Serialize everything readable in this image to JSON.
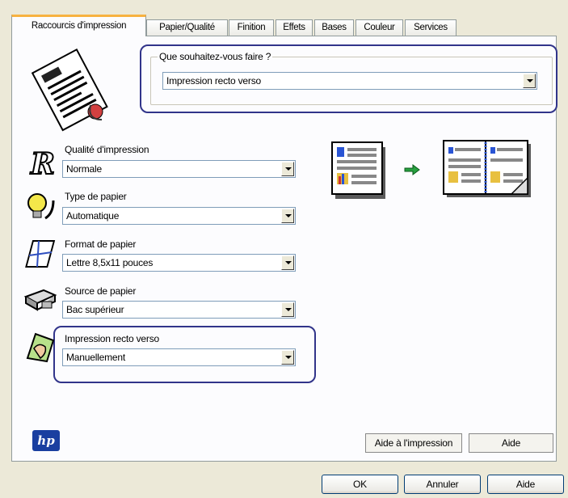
{
  "tabs": [
    "Raccourcis d'impression",
    "Papier/Qualité",
    "Finition",
    "Effets",
    "Bases",
    "Couleur",
    "Services"
  ],
  "task": {
    "label": "Que souhaitez-vous faire ?",
    "value": "Impression recto verso"
  },
  "quality": {
    "label": "Qualité d'impression",
    "value": "Normale"
  },
  "paper_type": {
    "label": "Type de papier",
    "value": "Automatique"
  },
  "paper_size": {
    "label": "Format de papier",
    "value": "Lettre 8,5x11 pouces"
  },
  "paper_source": {
    "label": "Source de papier",
    "value": "Bac supérieur"
  },
  "duplex": {
    "label": "Impression recto verso",
    "value": "Manuellement"
  },
  "buttons": {
    "print_help": "Aide à l'impression",
    "help": "Aide",
    "ok": "OK",
    "cancel": "Annuler",
    "help2": "Aide"
  },
  "colors": {
    "highlight": "#31348a",
    "accent": "#f7b240"
  }
}
